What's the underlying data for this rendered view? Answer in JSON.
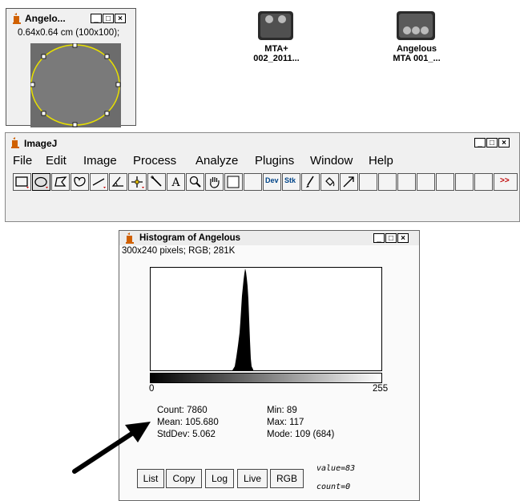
{
  "image_window": {
    "title": "Angelo...",
    "subtitle": "0.64x0.64 cm (100x100);"
  },
  "desktop_icons": [
    {
      "line1": "MTA+",
      "line2": "002_2011..."
    },
    {
      "line1": "Angelous",
      "line2": "MTA 001_..."
    }
  ],
  "imagej": {
    "title": "ImageJ",
    "menus": [
      "File",
      "Edit",
      "Image",
      "Process",
      "Analyze",
      "Plugins",
      "Window",
      "Help"
    ],
    "tools": {
      "dev": "Dev",
      "stk": "Stk",
      "more": ">>"
    }
  },
  "histogram": {
    "title": "Histogram of Angelous",
    "subtitle": "300x240 pixels; RGB; 281K",
    "axis_min": "0",
    "axis_max": "255",
    "stats_left": [
      "Count: 7860",
      "Mean: 105.680",
      "StdDev: 5.062"
    ],
    "stats_right": [
      "Min: 89",
      "Max: 117",
      "Mode: 109 (684)"
    ],
    "buttons": [
      "List",
      "Copy",
      "Log",
      "Live",
      "RGB"
    ],
    "value_text": "value=83",
    "count_text": "count=0"
  },
  "window_buttons": {
    "min": "_",
    "max": "□",
    "close": "×"
  },
  "colors": {
    "selection_outline": "#e8e000",
    "title_accent": "#d06000"
  }
}
